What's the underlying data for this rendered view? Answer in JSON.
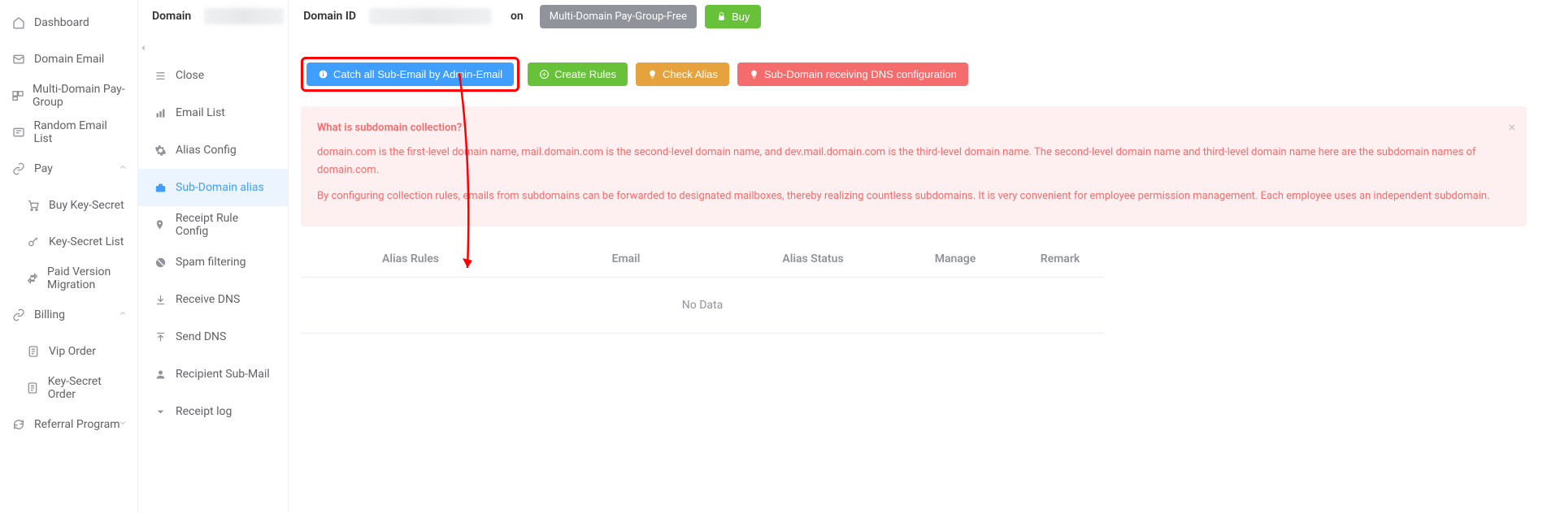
{
  "left_nav": {
    "dashboard": "Dashboard",
    "domain_email": "Domain Email",
    "multi_domain_pay_group": "Multi-Domain Pay-Group",
    "random_email_list": "Random Email List",
    "pay": "Pay",
    "buy_key_secret": "Buy Key-Secret",
    "key_secret_list": "Key-Secret List",
    "paid_version_migration": "Paid Version Migration",
    "billing": "Billing",
    "vip_order": "Vip Order",
    "key_secret_order": "Key-Secret Order",
    "referral_program": "Referral Program"
  },
  "mid_nav": {
    "close": "Close",
    "email_list": "Email List",
    "alias_config": "Alias Config",
    "sub_domain_alias": "Sub-Domain alias",
    "receipt_rule_config": "Receipt Rule Config",
    "spam_filtering": "Spam filtering",
    "receive_dns": "Receive DNS",
    "send_dns": "Send DNS",
    "recipient_sub_mail": "Recipient Sub-Mail",
    "receipt_log": "Receipt log"
  },
  "top_bar": {
    "domain_label": "Domain",
    "domain_id_label": "Domain ID",
    "suffix": "on",
    "badge": "Multi-Domain Pay-Group-Free",
    "buy": "Buy"
  },
  "actions": {
    "catch_all": "Catch all Sub-Email by Admin-Email",
    "create_rules": "Create Rules",
    "check_alias": "Check Alias",
    "dns_config": "Sub-Domain receiving DNS configuration"
  },
  "alert": {
    "title": "What is subdomain collection?",
    "p1": "domain.com is the first-level domain name, mail.domain.com is the second-level domain name, and dev.mail.domain.com is the third-level domain name. The second-level domain name and third-level domain name here are the subdomain names of domain.com.",
    "p2": "By configuring collection rules, emails from subdomains can be forwarded to designated mailboxes, thereby realizing countless subdomains. It is very convenient for employee permission management. Each employee uses an independent subdomain."
  },
  "table": {
    "alias_rules": "Alias Rules",
    "email": "Email",
    "alias_status": "Alias Status",
    "manage": "Manage",
    "remark": "Remark",
    "no_data": "No Data"
  }
}
